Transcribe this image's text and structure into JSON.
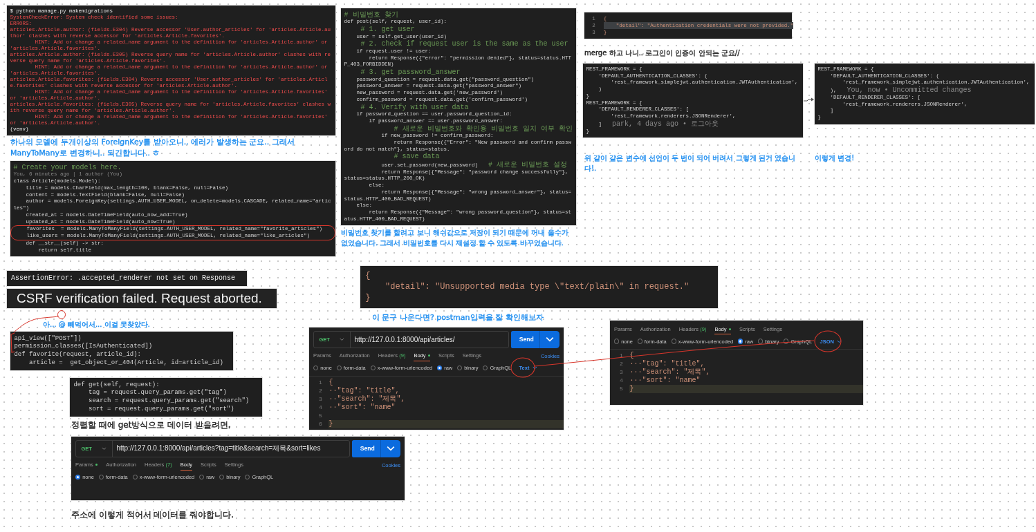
{
  "canvas": {
    "items": [
      {
        "kind": "terminal",
        "lines": [
          {
            "text": "$ python manage.py makemigrations",
            "kind": "plain"
          },
          {
            "text": "SystemCheckError: System check identified some issues:",
            "kind": "error"
          },
          {
            "text": "ERRORS:",
            "kind": "error"
          },
          {
            "text": "articles.Article.author: (fields.E304) Reverse accessor 'User.author_articles' for 'articles.Article.author' clashes with reverse accessor for 'articles.Article.favorites'.",
            "kind": "error"
          },
          {
            "text": "        HINT: Add or change a related_name argument to the definition for 'articles.Article.author' or 'articles.Article.favorites'.",
            "kind": "error"
          },
          {
            "text": "articles.Article.author: (fields.E305) Reverse query name for 'articles.Article.author' clashes with reverse query name for 'articles.Article.favorites'.",
            "kind": "error"
          },
          {
            "text": "        HINT: Add or change a related_name argument to the definition for 'articles.Article.author' or 'articles.Article.favorites'.",
            "kind": "error"
          },
          {
            "text": "articles.Article.favorites: (fields.E304) Reverse accessor 'User.author_articles' for 'articles.Article.favorites' clashes with reverse accessor for 'articles.Article.author'.",
            "kind": "error"
          },
          {
            "text": "        HINT: Add or change a related_name argument to the definition for 'articles.Article.favorites' or 'articles.Article.author'.",
            "kind": "error"
          },
          {
            "text": "articles.Article.favorites: (fields.E305) Reverse query name for 'articles.Article.favorites' clashes with reverse query name for 'articles.Article.author'.",
            "kind": "error"
          },
          {
            "text": "        HINT: Add or change a related_name argument to the definition for 'articles.Article.favorites' or 'articles.Article.author'.",
            "kind": "error"
          },
          {
            "text": "(venv)",
            "kind": "plain"
          }
        ]
      },
      {
        "kind": "caption",
        "text": "하나의 모델에 두개이상의 ForeignKey를 받아오니.. 에러가 발생하는 군요.. 그래서 ManyToMany로 변경하니.. 되긴합니다.. ㅎ",
        "color": "#1a8cf0"
      },
      {
        "kind": "code",
        "lines": [
          {
            "text": "# Create your models here.",
            "kind": "comment"
          },
          {
            "text": "You, 6 minutes ago | 1 author (You)",
            "kind": "blame"
          },
          {
            "text": "class Article(models.Model):",
            "kind": "code"
          },
          {
            "text": "    title = models.CharField(max_length=100, blank=False, null=False)",
            "kind": "code"
          },
          {
            "text": "    content = models.TextField(blank=False, null=False)",
            "kind": "code"
          },
          {
            "text": "    author = models.ForeignKey(settings.AUTH_USER_MODEL, on_delete=models.CASCADE, related_name=\"articles\")",
            "kind": "code"
          },
          {
            "text": "    created_at = models.DateTimeField(auto_now_add=True)",
            "kind": "code"
          },
          {
            "text": "    updated_at = models.DateTimeField(auto_now=True)",
            "kind": "code"
          },
          {
            "text": "    favorites  = models.ManyToManyField(settings.AUTH_USER_MODEL, related_name=\"favorite_articles\")",
            "kind": "code"
          },
          {
            "text": "    like_users = models.ManyToManyField(settings.AUTH_USER_MODEL, related_name=\"like_articles\")",
            "kind": "code"
          },
          {
            "text": "    def __str__(self) -> str:",
            "kind": "code"
          },
          {
            "text": "        return self.title",
            "kind": "code"
          }
        ]
      },
      {
        "kind": "code",
        "lines": [
          {
            "text": "# 비밀번호 찾기",
            "kind": "comment"
          },
          {
            "text": "def post(self, request, user_id):",
            "kind": "code"
          },
          {
            "text": "    # 1. get user",
            "kind": "comment"
          },
          {
            "text": "    user = self.get_user(user_id)",
            "kind": "code"
          },
          {
            "text": "    # 2. check if request user is the same as the user",
            "kind": "comment"
          },
          {
            "text": "    if request.user != user:",
            "kind": "code"
          },
          {
            "text": "        return Response({\"error\": \"permission denied\"}, status=status.HTTP_403_FORBIDDEN)",
            "kind": "code"
          },
          {
            "text": "    # 3. get password_answer",
            "kind": "comment"
          },
          {
            "text": "    password_question = request.data.get(\"password_question\")",
            "kind": "code"
          },
          {
            "text": "    password_answer = request.data.get(\"password_answer\")",
            "kind": "code"
          },
          {
            "text": "    new_password = request.data.get('new_password')",
            "kind": "code"
          },
          {
            "text": "    confirm_password = request.data.get('confirm_password')",
            "kind": "code"
          },
          {
            "text": "    # 4. Verify with user data",
            "kind": "comment"
          },
          {
            "text": "    if password_question == user.password_question_id:",
            "kind": "code"
          },
          {
            "text": "        if password_answer == user.password_answer:",
            "kind": "code"
          },
          {
            "text": "            # 새로운 비밀번호와 확인용 비밀번호 일치 여부 확인",
            "kind": "comment"
          },
          {
            "text": "            if new_password != confirm_password:",
            "kind": "code"
          },
          {
            "text": "                return Response({\"Error\": \"New password and confirm password do not match\"}, status=status.",
            "kind": "code"
          },
          {
            "text": "            # save data",
            "kind": "comment"
          },
          {
            "text": "            user.set_password(new_password)",
            "kind": "code",
            "note": {
              "text": "# 새로운 비밀번호 설정",
              "kind": "comment"
            }
          },
          {
            "text": "            return Response({\"Message\": \"password change successfully\"}, status=status.HTTP_200_OK)",
            "kind": "code"
          },
          {
            "text": "        else:",
            "kind": "code"
          },
          {
            "text": "            return Response({\"Message\": \"wrong password_answer\"}, status=status.HTTP_400_BAD_REQUEST)",
            "kind": "code"
          },
          {
            "text": "    else:",
            "kind": "code"
          },
          {
            "text": "        return Response({\"Message\": \"wrong password_question\"}, status=status.HTTP_400_BAD_REQUEST)",
            "kind": "code"
          }
        ]
      },
      {
        "kind": "caption",
        "text": "비밀번호 찾기를 할려고 보니 해쉬값으로 저장이 되기 때문에 꺼내 올수가 없었습니다. 그래서 비밀번호를 다시 재설정 할 수 있도록 바꾸었습니다.",
        "color": "#1a8cf0"
      },
      {
        "kind": "json",
        "lines": [
          {
            "number": "1",
            "text": "{",
            "highlighted": false
          },
          {
            "number": "2",
            "text": "    \"detail\": \"Authentication credentials were not provided.\"",
            "highlighted": true
          },
          {
            "number": "3",
            "text": "}",
            "highlighted": false
          }
        ]
      },
      {
        "kind": "caption",
        "text": "merge 하고 나니.. 로그인이 인증이 안되는 군요//",
        "color": "#222222"
      },
      {
        "kind": "code",
        "lines": [
          {
            "text": "REST_FRAMEWORK = {",
            "kind": "code"
          },
          {
            "text": "    'DEFAULT_AUTHENTICATION_CLASSES': (",
            "kind": "code"
          },
          {
            "text": "        'rest_framework_simplejwt.authentication.JWTAuthentication',",
            "kind": "code"
          },
          {
            "text": "    )",
            "kind": "code"
          },
          {
            "text": "}",
            "kind": "code"
          },
          {
            "text": "REST_FRAMEWORK = {",
            "kind": "code"
          },
          {
            "text": "    'DEFAULT_RENDERER_CLASSES': [",
            "kind": "code"
          },
          {
            "text": "        'rest_framework.renderers.JSONRenderer',",
            "kind": "code"
          },
          {
            "text": "    ]",
            "kind": "code",
            "note": {
              "text": "park, 4 days ago • 로그아웃",
              "kind": "blame"
            }
          },
          {
            "text": "}",
            "kind": "code"
          }
        ]
      },
      {
        "kind": "code",
        "lines": [
          {
            "text": "REST_FRAMEWORK = {",
            "kind": "code"
          },
          {
            "text": "    'DEFAULT_AUTHENTICATION_CLASSES': (",
            "kind": "code"
          },
          {
            "text": "        'rest_framework_simplejwt.authentication.JWTAuthentication',",
            "kind": "code"
          },
          {
            "text": "    ),",
            "kind": "code",
            "note": {
              "text": "You, now • Uncommitted changes",
              "kind": "blame"
            }
          },
          {
            "text": "    'DEFAULT_RENDERER_CLASSES': [",
            "kind": "code"
          },
          {
            "text": "        'rest_framework.renderers.JSONRenderer',",
            "kind": "code"
          },
          {
            "text": "    ]",
            "kind": "code"
          },
          {
            "text": "}",
            "kind": "code"
          }
        ]
      },
      {
        "kind": "caption",
        "text": "위 같이 같은 변수에 선언이 두 번이 되어 버려서 그렇게 된거 였습니다!.",
        "color": "#1a8cf0"
      },
      {
        "kind": "caption",
        "text": "이렇게 변경!",
        "color": "#1a8cf0"
      },
      {
        "kind": "terminal",
        "lines": [
          {
            "text": "AssertionError: .accepted_renderer not set on Response",
            "kind": "plain"
          }
        ]
      },
      {
        "kind": "banner",
        "text": "CSRF verification failed. Request aborted."
      },
      {
        "kind": "caption",
        "text": "아... @ 빼먹어서... 이걸 못찾았다.",
        "color": "#1a8cf0"
      },
      {
        "kind": "code",
        "lines": [
          {
            "text": "api_view([\"POST\"])",
            "kind": "code"
          },
          {
            "text": "permission_classes([IsAuthenticated])",
            "kind": "code"
          },
          {
            "text": "def favorite(request, article_id):",
            "kind": "code"
          },
          {
            "text": "    article =  get_object_or_404(Article, id=article_id)",
            "kind": "code"
          }
        ]
      },
      {
        "kind": "json",
        "lines": [
          {
            "text": "{",
            "highlighted": false
          },
          {
            "text": "    \"detail\": \"Unsupported media type \\\"text/plain\\\" in request.\"",
            "highlighted": false
          },
          {
            "text": "}",
            "highlighted": false
          }
        ]
      },
      {
        "kind": "caption",
        "text": "이 문구 나온다면? postman입력을 잘 확인해보자",
        "color": "#1a8cf0"
      },
      {
        "kind": "postman",
        "method": "GET",
        "url": "http://127.0.0.1:8000/api/articles/",
        "send": "Send",
        "tabs": [
          {
            "label": "Params",
            "selected": false,
            "dot": false
          },
          {
            "label": "Authorization",
            "selected": false,
            "dot": false
          },
          {
            "label": "Headers",
            "count": "(9)",
            "selected": false,
            "dot": false
          },
          {
            "label": "Body",
            "selected": true,
            "dot": true
          },
          {
            "label": "Scripts",
            "selected": false,
            "dot": false
          },
          {
            "label": "Settings",
            "selected": false,
            "dot": false
          }
        ],
        "cookies": "Cookies",
        "modes": [
          {
            "label": "none",
            "selected": false
          },
          {
            "label": "form-data",
            "selected": false
          },
          {
            "label": "x-www-form-urlencoded",
            "selected": false
          },
          {
            "label": "raw",
            "selected": true
          },
          {
            "label": "binary",
            "selected": false
          },
          {
            "label": "GraphQL",
            "selected": false
          }
        ],
        "format": "Text",
        "editor": [
          {
            "number": "1",
            "text": "{",
            "current": false
          },
          {
            "number": "2",
            "text": "··\"tag\": \"title\",",
            "current": false
          },
          {
            "number": "3",
            "text": "··\"search\": \"제목\",",
            "current": false
          },
          {
            "number": "4",
            "text": "··\"sort\": \"name\"",
            "current": false
          },
          {
            "number": "5",
            "current": false
          },
          {
            "number": "6",
            "text": "}",
            "current": true
          }
        ]
      },
      {
        "kind": "postman",
        "tabs": [
          {
            "label": "Params",
            "selected": false,
            "dot": false
          },
          {
            "label": "Authorization",
            "selected": false,
            "dot": false
          },
          {
            "label": "Headers",
            "count": "(9)",
            "selected": false,
            "dot": false
          },
          {
            "label": "Body",
            "selected": true,
            "dot": true
          },
          {
            "label": "Scripts",
            "selected": false,
            "dot": false
          },
          {
            "label": "Settings",
            "selected": false,
            "dot": false
          }
        ],
        "modes": [
          {
            "label": "none",
            "selected": false
          },
          {
            "label": "form-data",
            "selected": false
          },
          {
            "label": "x-www-form-urlencoded",
            "selected": false
          },
          {
            "label": "raw",
            "selected": true
          },
          {
            "label": "binary",
            "selected": false
          },
          {
            "label": "GraphQL",
            "selected": false
          }
        ],
        "format": "JSON",
        "editor": [
          {
            "number": "1",
            "text": "{",
            "current": false
          },
          {
            "number": "2",
            "text": "···\"tag\": \"title\",",
            "current": false
          },
          {
            "number": "3",
            "text": "···\"search\": \"제목\",",
            "current": false
          },
          {
            "number": "4",
            "text": "···\"sort\": \"name\"",
            "current": false
          },
          {
            "number": "5",
            "text": "}",
            "current": true
          }
        ]
      },
      {
        "kind": "code",
        "lines": [
          {
            "text": "def get(self, request):",
            "kind": "code"
          },
          {
            "text": "    tag = request.query_params.get(\"tag\")",
            "kind": "code"
          },
          {
            "text": "    search = request.query_params.get(\"search\")",
            "kind": "code"
          },
          {
            "text": "    sort = request.query_params.get(\"sort\")",
            "kind": "code"
          }
        ]
      },
      {
        "kind": "caption",
        "text": "정렬할 때에 get방식으로 데이터 받을려면,",
        "color": "#222222"
      },
      {
        "kind": "postman",
        "method": "GET",
        "url": "http://127.0.0.1:8000/api/articles?tag=title&search=제목&sort=likes",
        "send": "Send",
        "tabs": [
          {
            "label": "Params",
            "selected": false,
            "dot": true
          },
          {
            "label": "Authorization",
            "selected": false,
            "dot": false
          },
          {
            "label": "Headers",
            "count": "(7)",
            "selected": false,
            "dot": false
          },
          {
            "label": "Body",
            "selected": true,
            "dot": false
          },
          {
            "label": "Scripts",
            "selected": false,
            "dot": false
          },
          {
            "label": "Settings",
            "selected": false,
            "dot": false
          }
        ],
        "cookies": "Cookies",
        "modes": [
          {
            "label": "none",
            "selected": true
          },
          {
            "label": "form-data",
            "selected": false
          },
          {
            "label": "x-www-form-urlencoded",
            "selected": false
          },
          {
            "label": "raw",
            "selected": false
          },
          {
            "label": "binary",
            "selected": false
          },
          {
            "label": "GraphQL",
            "selected": false
          }
        ]
      },
      {
        "kind": "caption",
        "text": "주소에 이렇게 적어서 데이터를 줘야합니다.",
        "color": "#222222"
      }
    ]
  }
}
